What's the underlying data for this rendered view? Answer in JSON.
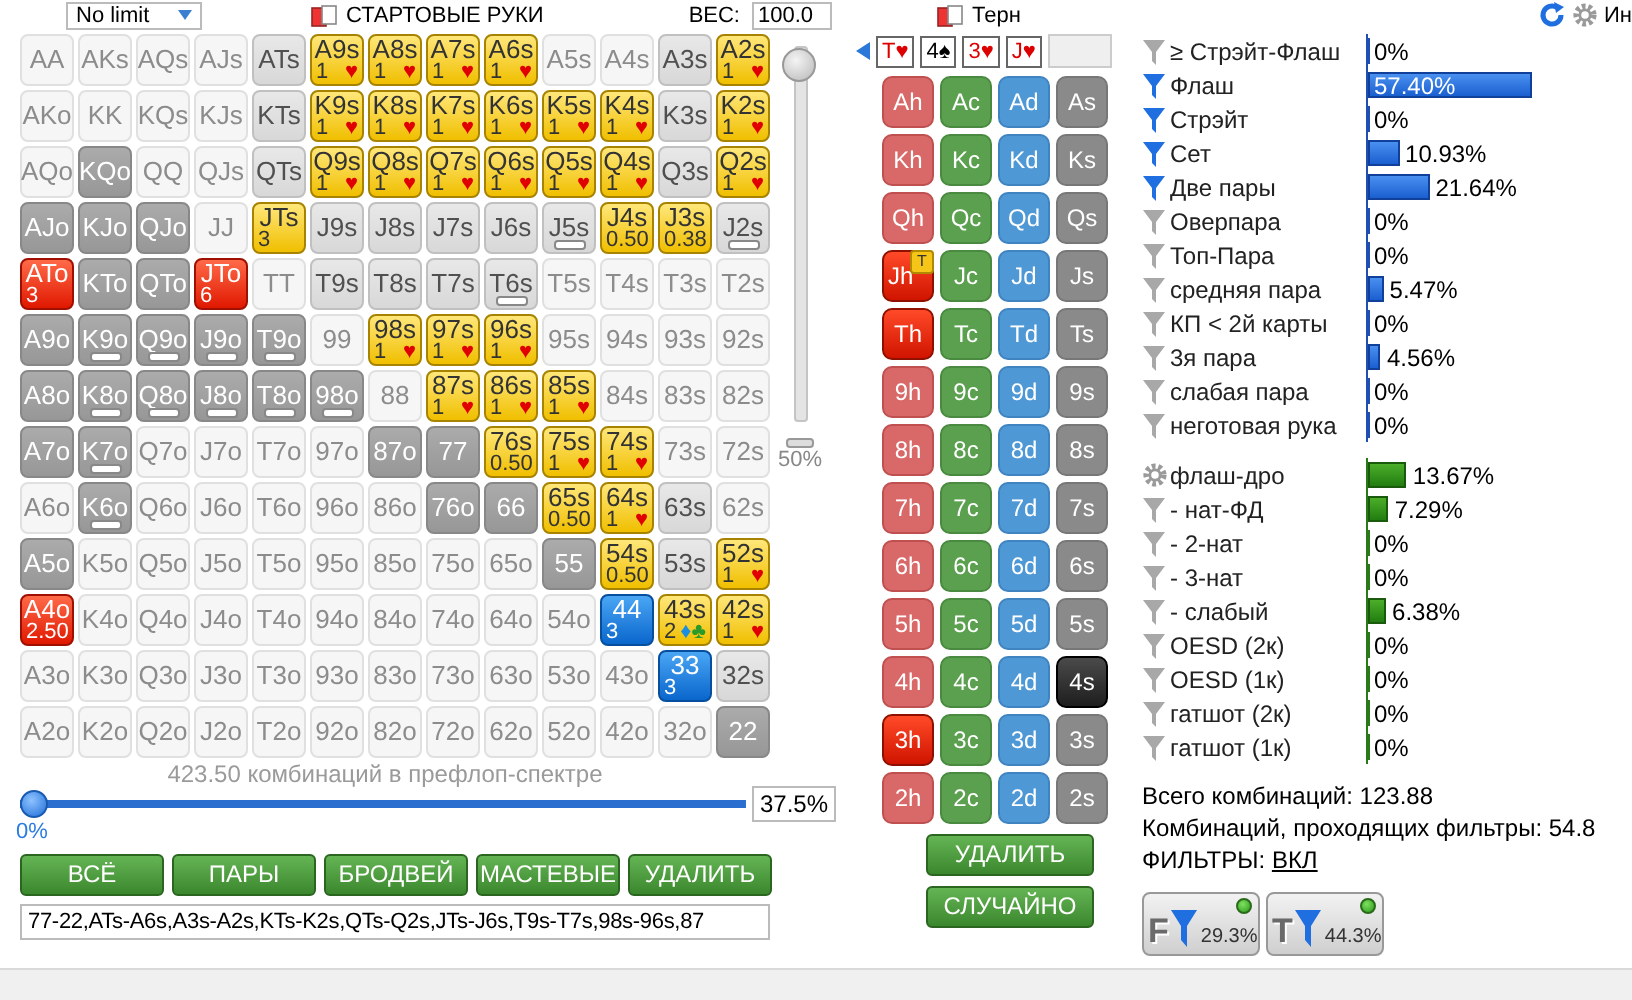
{
  "header": {
    "game": "No limit",
    "section": "СТАРТОВЫЕ РУКИ",
    "weight_label": "ВЕС:",
    "weight": "100.0",
    "street": "Терн",
    "info": "Ин"
  },
  "range": {
    "cells": [
      {
        "label": "AA",
        "kind": "faint",
        "bar": false
      },
      {
        "label": "AKs",
        "kind": "faint",
        "bar": false
      },
      {
        "label": "AQs",
        "kind": "faint",
        "bar": false
      },
      {
        "label": "AJs",
        "kind": "faint",
        "bar": false
      },
      {
        "label": "ATs",
        "kind": "mid",
        "bar": false
      },
      {
        "label": "A9s",
        "kind": "yellow",
        "bar": false,
        "count": "1",
        "suits": [
          {
            "symbol": "♥",
            "color": "#e00000"
          }
        ]
      },
      {
        "label": "A8s",
        "kind": "yellow",
        "bar": false,
        "count": "1",
        "suits": [
          {
            "symbol": "♥",
            "color": "#e00000"
          }
        ]
      },
      {
        "label": "A7s",
        "kind": "yellow",
        "bar": false,
        "count": "1",
        "suits": [
          {
            "symbol": "♥",
            "color": "#e00000"
          }
        ]
      },
      {
        "label": "A6s",
        "kind": "yellow",
        "bar": false,
        "count": "1",
        "suits": [
          {
            "symbol": "♥",
            "color": "#e00000"
          }
        ]
      },
      {
        "label": "A5s",
        "kind": "faint",
        "bar": false
      },
      {
        "label": "A4s",
        "kind": "faint",
        "bar": false
      },
      {
        "label": "A3s",
        "kind": "mid",
        "bar": false
      },
      {
        "label": "A2s",
        "kind": "yellow",
        "bar": false,
        "count": "1",
        "suits": [
          {
            "symbol": "♥",
            "color": "#e00000"
          }
        ]
      },
      {
        "label": "AKo",
        "kind": "faint",
        "bar": false
      },
      {
        "label": "KK",
        "kind": "faint",
        "bar": false
      },
      {
        "label": "KQs",
        "kind": "faint",
        "bar": false
      },
      {
        "label": "KJs",
        "kind": "faint",
        "bar": false
      },
      {
        "label": "KTs",
        "kind": "mid",
        "bar": false
      },
      {
        "label": "K9s",
        "kind": "yellow",
        "bar": false,
        "count": "1",
        "suits": [
          {
            "symbol": "♥",
            "color": "#e00000"
          }
        ]
      },
      {
        "label": "K8s",
        "kind": "yellow",
        "bar": false,
        "count": "1",
        "suits": [
          {
            "symbol": "♥",
            "color": "#e00000"
          }
        ]
      },
      {
        "label": "K7s",
        "kind": "yellow",
        "bar": false,
        "count": "1",
        "suits": [
          {
            "symbol": "♥",
            "color": "#e00000"
          }
        ]
      },
      {
        "label": "K6s",
        "kind": "yellow",
        "bar": false,
        "count": "1",
        "suits": [
          {
            "symbol": "♥",
            "color": "#e00000"
          }
        ]
      },
      {
        "label": "K5s",
        "kind": "yellow",
        "bar": false,
        "count": "1",
        "suits": [
          {
            "symbol": "♥",
            "color": "#e00000"
          }
        ]
      },
      {
        "label": "K4s",
        "kind": "yellow",
        "bar": false,
        "count": "1",
        "suits": [
          {
            "symbol": "♥",
            "color": "#e00000"
          }
        ]
      },
      {
        "label": "K3s",
        "kind": "mid",
        "bar": false
      },
      {
        "label": "K2s",
        "kind": "yellow",
        "bar": false,
        "count": "1",
        "suits": [
          {
            "symbol": "♥",
            "color": "#e00000"
          }
        ]
      },
      {
        "label": "AQo",
        "kind": "faint",
        "bar": false
      },
      {
        "label": "KQo",
        "kind": "dark",
        "bar": false
      },
      {
        "label": "QQ",
        "kind": "faint",
        "bar": false
      },
      {
        "label": "QJs",
        "kind": "faint",
        "bar": false
      },
      {
        "label": "QTs",
        "kind": "mid",
        "bar": false
      },
      {
        "label": "Q9s",
        "kind": "yellow",
        "bar": false,
        "count": "1",
        "suits": [
          {
            "symbol": "♥",
            "color": "#e00000"
          }
        ]
      },
      {
        "label": "Q8s",
        "kind": "yellow",
        "bar": false,
        "count": "1",
        "suits": [
          {
            "symbol": "♥",
            "color": "#e00000"
          }
        ]
      },
      {
        "label": "Q7s",
        "kind": "yellow",
        "bar": false,
        "count": "1",
        "suits": [
          {
            "symbol": "♥",
            "color": "#e00000"
          }
        ]
      },
      {
        "label": "Q6s",
        "kind": "yellow",
        "bar": false,
        "count": "1",
        "suits": [
          {
            "symbol": "♥",
            "color": "#e00000"
          }
        ]
      },
      {
        "label": "Q5s",
        "kind": "yellow",
        "bar": false,
        "count": "1",
        "suits": [
          {
            "symbol": "♥",
            "color": "#e00000"
          }
        ]
      },
      {
        "label": "Q4s",
        "kind": "yellow",
        "bar": false,
        "count": "1",
        "suits": [
          {
            "symbol": "♥",
            "color": "#e00000"
          }
        ]
      },
      {
        "label": "Q3s",
        "kind": "mid",
        "bar": false
      },
      {
        "label": "Q2s",
        "kind": "yellow",
        "bar": false,
        "count": "1",
        "suits": [
          {
            "symbol": "♥",
            "color": "#e00000"
          }
        ]
      },
      {
        "label": "AJo",
        "kind": "dark",
        "bar": false
      },
      {
        "label": "KJo",
        "kind": "dark",
        "bar": false
      },
      {
        "label": "QJo",
        "kind": "dark",
        "bar": false
      },
      {
        "label": "JJ",
        "kind": "faint",
        "bar": false
      },
      {
        "label": "JTs",
        "kind": "yellow",
        "bar": false,
        "count": "3"
      },
      {
        "label": "J9s",
        "kind": "mid",
        "bar": false
      },
      {
        "label": "J8s",
        "kind": "mid",
        "bar": false
      },
      {
        "label": "J7s",
        "kind": "mid",
        "bar": false
      },
      {
        "label": "J6s",
        "kind": "mid",
        "bar": false
      },
      {
        "label": "J5s",
        "kind": "mid",
        "bar": true
      },
      {
        "label": "J4s",
        "kind": "yellow",
        "bar": false,
        "count": "0.50"
      },
      {
        "label": "J3s",
        "kind": "yellow",
        "bar": false,
        "count": "0.38"
      },
      {
        "label": "J2s",
        "kind": "mid",
        "bar": true
      },
      {
        "label": "ATo",
        "kind": "red",
        "bar": false,
        "count": "3"
      },
      {
        "label": "KTo",
        "kind": "dark",
        "bar": false
      },
      {
        "label": "QTo",
        "kind": "dark",
        "bar": false
      },
      {
        "label": "JTo",
        "kind": "red",
        "bar": false,
        "count": "6"
      },
      {
        "label": "TT",
        "kind": "faint",
        "bar": false
      },
      {
        "label": "T9s",
        "kind": "mid",
        "bar": false
      },
      {
        "label": "T8s",
        "kind": "mid",
        "bar": false
      },
      {
        "label": "T7s",
        "kind": "mid",
        "bar": false
      },
      {
        "label": "T6s",
        "kind": "mid",
        "bar": true
      },
      {
        "label": "T5s",
        "kind": "faint",
        "bar": false
      },
      {
        "label": "T4s",
        "kind": "faint",
        "bar": false
      },
      {
        "label": "T3s",
        "kind": "faint",
        "bar": false
      },
      {
        "label": "T2s",
        "kind": "faint",
        "bar": false
      },
      {
        "label": "A9o",
        "kind": "dark",
        "bar": false
      },
      {
        "label": "K9o",
        "kind": "dark",
        "bar": true
      },
      {
        "label": "Q9o",
        "kind": "dark",
        "bar": true
      },
      {
        "label": "J9o",
        "kind": "dark",
        "bar": true
      },
      {
        "label": "T9o",
        "kind": "dark",
        "bar": true
      },
      {
        "label": "99",
        "kind": "faint",
        "bar": false
      },
      {
        "label": "98s",
        "kind": "yellow",
        "bar": false,
        "count": "1",
        "suits": [
          {
            "symbol": "♥",
            "color": "#e00000"
          }
        ]
      },
      {
        "label": "97s",
        "kind": "yellow",
        "bar": false,
        "count": "1",
        "suits": [
          {
            "symbol": "♥",
            "color": "#e00000"
          }
        ]
      },
      {
        "label": "96s",
        "kind": "yellow",
        "bar": false,
        "count": "1",
        "suits": [
          {
            "symbol": "♥",
            "color": "#e00000"
          }
        ]
      },
      {
        "label": "95s",
        "kind": "faint",
        "bar": false
      },
      {
        "label": "94s",
        "kind": "faint",
        "bar": false
      },
      {
        "label": "93s",
        "kind": "faint",
        "bar": false
      },
      {
        "label": "92s",
        "kind": "faint",
        "bar": false
      },
      {
        "label": "A8o",
        "kind": "dark",
        "bar": false
      },
      {
        "label": "K8o",
        "kind": "dark",
        "bar": true
      },
      {
        "label": "Q8o",
        "kind": "dark",
        "bar": true
      },
      {
        "label": "J8o",
        "kind": "dark",
        "bar": true
      },
      {
        "label": "T8o",
        "kind": "dark",
        "bar": true
      },
      {
        "label": "98o",
        "kind": "dark",
        "bar": true
      },
      {
        "label": "88",
        "kind": "faint",
        "bar": false
      },
      {
        "label": "87s",
        "kind": "yellow",
        "bar": false,
        "count": "1",
        "suits": [
          {
            "symbol": "♥",
            "color": "#e00000"
          }
        ]
      },
      {
        "label": "86s",
        "kind": "yellow",
        "bar": false,
        "count": "1",
        "suits": [
          {
            "symbol": "♥",
            "color": "#e00000"
          }
        ]
      },
      {
        "label": "85s",
        "kind": "yellow",
        "bar": false,
        "count": "1",
        "suits": [
          {
            "symbol": "♥",
            "color": "#e00000"
          }
        ]
      },
      {
        "label": "84s",
        "kind": "faint",
        "bar": false
      },
      {
        "label": "83s",
        "kind": "faint",
        "bar": false
      },
      {
        "label": "82s",
        "kind": "faint",
        "bar": false
      },
      {
        "label": "A7o",
        "kind": "dark",
        "bar": false
      },
      {
        "label": "K7o",
        "kind": "dark",
        "bar": true
      },
      {
        "label": "Q7o",
        "kind": "faint",
        "bar": false
      },
      {
        "label": "J7o",
        "kind": "faint",
        "bar": false
      },
      {
        "label": "T7o",
        "kind": "faint",
        "bar": false
      },
      {
        "label": "97o",
        "kind": "faint",
        "bar": false
      },
      {
        "label": "87o",
        "kind": "dark",
        "bar": false
      },
      {
        "label": "77",
        "kind": "dark",
        "bar": false
      },
      {
        "label": "76s",
        "kind": "yellow",
        "bar": false,
        "count": "0.50"
      },
      {
        "label": "75s",
        "kind": "yellow",
        "bar": false,
        "count": "1",
        "suits": [
          {
            "symbol": "♥",
            "color": "#e00000"
          }
        ]
      },
      {
        "label": "74s",
        "kind": "yellow",
        "bar": false,
        "count": "1",
        "suits": [
          {
            "symbol": "♥",
            "color": "#e00000"
          }
        ]
      },
      {
        "label": "73s",
        "kind": "faint",
        "bar": false
      },
      {
        "label": "72s",
        "kind": "faint",
        "bar": false
      },
      {
        "label": "A6o",
        "kind": "faint",
        "bar": false
      },
      {
        "label": "K6o",
        "kind": "dark",
        "bar": true
      },
      {
        "label": "Q6o",
        "kind": "faint",
        "bar": false
      },
      {
        "label": "J6o",
        "kind": "faint",
        "bar": false
      },
      {
        "label": "T6o",
        "kind": "faint",
        "bar": false
      },
      {
        "label": "96o",
        "kind": "faint",
        "bar": false
      },
      {
        "label": "86o",
        "kind": "faint",
        "bar": false
      },
      {
        "label": "76o",
        "kind": "dark",
        "bar": false
      },
      {
        "label": "66",
        "kind": "dark",
        "bar": false
      },
      {
        "label": "65s",
        "kind": "yellow",
        "bar": false,
        "count": "0.50"
      },
      {
        "label": "64s",
        "kind": "yellow",
        "bar": false,
        "count": "1",
        "suits": [
          {
            "symbol": "♥",
            "color": "#e00000"
          }
        ]
      },
      {
        "label": "63s",
        "kind": "mid",
        "bar": false
      },
      {
        "label": "62s",
        "kind": "faint",
        "bar": false
      },
      {
        "label": "A5o",
        "kind": "dark",
        "bar": false
      },
      {
        "label": "K5o",
        "kind": "faint",
        "bar": false
      },
      {
        "label": "Q5o",
        "kind": "faint",
        "bar": false
      },
      {
        "label": "J5o",
        "kind": "faint",
        "bar": false
      },
      {
        "label": "T5o",
        "kind": "faint",
        "bar": false
      },
      {
        "label": "95o",
        "kind": "faint",
        "bar": false
      },
      {
        "label": "85o",
        "kind": "faint",
        "bar": false
      },
      {
        "label": "75o",
        "kind": "faint",
        "bar": false
      },
      {
        "label": "65o",
        "kind": "faint",
        "bar": false
      },
      {
        "label": "55",
        "kind": "dark",
        "bar": false
      },
      {
        "label": "54s",
        "kind": "yellow",
        "bar": false,
        "count": "0.50"
      },
      {
        "label": "53s",
        "kind": "mid",
        "bar": false
      },
      {
        "label": "52s",
        "kind": "yellow",
        "bar": false,
        "count": "1",
        "suits": [
          {
            "symbol": "♥",
            "color": "#e00000"
          }
        ]
      },
      {
        "label": "A4o",
        "kind": "red",
        "bar": false,
        "count": "2.50"
      },
      {
        "label": "K4o",
        "kind": "faint",
        "bar": false
      },
      {
        "label": "Q4o",
        "kind": "faint",
        "bar": false
      },
      {
        "label": "J4o",
        "kind": "faint",
        "bar": false
      },
      {
        "label": "T4o",
        "kind": "faint",
        "bar": false
      },
      {
        "label": "94o",
        "kind": "faint",
        "bar": false
      },
      {
        "label": "84o",
        "kind": "faint",
        "bar": false
      },
      {
        "label": "74o",
        "kind": "faint",
        "bar": false
      },
      {
        "label": "64o",
        "kind": "faint",
        "bar": false
      },
      {
        "label": "54o",
        "kind": "faint",
        "bar": false
      },
      {
        "label": "44",
        "kind": "blue",
        "bar": false,
        "count": "3"
      },
      {
        "label": "43s",
        "kind": "yellow",
        "bar": false,
        "count": "2",
        "suits": [
          {
            "symbol": "♦",
            "color": "#1a8fe0"
          },
          {
            "symbol": "♣",
            "color": "#2a9a2a"
          }
        ]
      },
      {
        "label": "42s",
        "kind": "yellow",
        "bar": false,
        "count": "1",
        "suits": [
          {
            "symbol": "♥",
            "color": "#e00000"
          }
        ]
      },
      {
        "label": "A3o",
        "kind": "faint",
        "bar": false
      },
      {
        "label": "K3o",
        "kind": "faint",
        "bar": false
      },
      {
        "label": "Q3o",
        "kind": "faint",
        "bar": false
      },
      {
        "label": "J3o",
        "kind": "faint",
        "bar": false
      },
      {
        "label": "T3o",
        "kind": "faint",
        "bar": false
      },
      {
        "label": "93o",
        "kind": "faint",
        "bar": false
      },
      {
        "label": "83o",
        "kind": "faint",
        "bar": false
      },
      {
        "label": "73o",
        "kind": "faint",
        "bar": false
      },
      {
        "label": "63o",
        "kind": "faint",
        "bar": false
      },
      {
        "label": "53o",
        "kind": "faint",
        "bar": false
      },
      {
        "label": "43o",
        "kind": "faint",
        "bar": false
      },
      {
        "label": "33",
        "kind": "blue",
        "bar": false,
        "count": "3"
      },
      {
        "label": "32s",
        "kind": "mid",
        "bar": false
      },
      {
        "label": "A2o",
        "kind": "faint",
        "bar": false
      },
      {
        "label": "K2o",
        "kind": "faint",
        "bar": false
      },
      {
        "label": "Q2o",
        "kind": "faint",
        "bar": false
      },
      {
        "label": "J2o",
        "kind": "faint",
        "bar": false
      },
      {
        "label": "T2o",
        "kind": "faint",
        "bar": false
      },
      {
        "label": "92o",
        "kind": "faint",
        "bar": false
      },
      {
        "label": "82o",
        "kind": "faint",
        "bar": false
      },
      {
        "label": "72o",
        "kind": "faint",
        "bar": false
      },
      {
        "label": "62o",
        "kind": "faint",
        "bar": false
      },
      {
        "label": "52o",
        "kind": "faint",
        "bar": false
      },
      {
        "label": "42o",
        "kind": "faint",
        "bar": false
      },
      {
        "label": "32o",
        "kind": "faint",
        "bar": false
      },
      {
        "label": "22",
        "kind": "dark",
        "bar": false
      }
    ],
    "vertical_slider": {
      "level": 1,
      "reading": "50%"
    },
    "summary": "423.50 комбинаций в префлоп-спектре",
    "slider": {
      "level": 0,
      "min_label": "0%",
      "value": "37.5%"
    },
    "buttons": [
      "ВСЁ",
      "ПАРЫ",
      "БРОДВЕЙ",
      "МАСТЕВЫЕ",
      "УДАЛИТЬ"
    ],
    "text": "77-22,ATs-A6s,A3s-A2s,KTs-K2s,QTs-Q2s,JTs-J6s,T9s-T7s,98s-96s,87"
  },
  "board": {
    "cards": [
      {
        "kind": "card",
        "label": "T♥",
        "color": "#dd0000"
      },
      {
        "kind": "card",
        "label": "4♠",
        "color": "#000000"
      },
      {
        "kind": "card",
        "label": "3♥",
        "color": "#dd0000"
      },
      {
        "kind": "card",
        "label": "J♥",
        "color": "#dd0000"
      },
      {
        "kind": "empty"
      }
    ]
  },
  "deck": {
    "columns": [
      {
        "kind": "heart",
        "cards": [
          {
            "label": "Ah",
            "selected": false
          },
          {
            "label": "Kh",
            "selected": false
          },
          {
            "label": "Qh",
            "selected": false
          },
          {
            "label": "Jh",
            "selected": true,
            "badge": "T"
          },
          {
            "label": "Th",
            "selected": true
          },
          {
            "label": "9h",
            "selected": false
          },
          {
            "label": "8h",
            "selected": false
          },
          {
            "label": "7h",
            "selected": false
          },
          {
            "label": "6h",
            "selected": false
          },
          {
            "label": "5h",
            "selected": false
          },
          {
            "label": "4h",
            "selected": false
          },
          {
            "label": "3h",
            "selected": true
          },
          {
            "label": "2h",
            "selected": false
          }
        ]
      },
      {
        "kind": "club",
        "cards": [
          {
            "label": "Ac",
            "selected": false
          },
          {
            "label": "Kc",
            "selected": false
          },
          {
            "label": "Qc",
            "selected": false
          },
          {
            "label": "Jc",
            "selected": false
          },
          {
            "label": "Tc",
            "selected": false
          },
          {
            "label": "9c",
            "selected": false
          },
          {
            "label": "8c",
            "selected": false
          },
          {
            "label": "7c",
            "selected": false
          },
          {
            "label": "6c",
            "selected": false
          },
          {
            "label": "5c",
            "selected": false
          },
          {
            "label": "4c",
            "selected": false
          },
          {
            "label": "3c",
            "selected": false
          },
          {
            "label": "2c",
            "selected": false
          }
        ]
      },
      {
        "kind": "diamond",
        "cards": [
          {
            "label": "Ad",
            "selected": false
          },
          {
            "label": "Kd",
            "selected": false
          },
          {
            "label": "Qd",
            "selected": false
          },
          {
            "label": "Jd",
            "selected": false
          },
          {
            "label": "Td",
            "selected": false
          },
          {
            "label": "9d",
            "selected": false
          },
          {
            "label": "8d",
            "selected": false
          },
          {
            "label": "7d",
            "selected": false
          },
          {
            "label": "6d",
            "selected": false
          },
          {
            "label": "5d",
            "selected": false
          },
          {
            "label": "4d",
            "selected": false
          },
          {
            "label": "3d",
            "selected": false
          },
          {
            "label": "2d",
            "selected": false
          }
        ]
      },
      {
        "kind": "spade",
        "cards": [
          {
            "label": "As",
            "selected": false
          },
          {
            "label": "Ks",
            "selected": false
          },
          {
            "label": "Qs",
            "selected": false
          },
          {
            "label": "Js",
            "selected": false
          },
          {
            "label": "Ts",
            "selected": false
          },
          {
            "label": "9s",
            "selected": false
          },
          {
            "label": "8s",
            "selected": false
          },
          {
            "label": "7s",
            "selected": false
          },
          {
            "label": "6s",
            "selected": false
          },
          {
            "label": "5s",
            "selected": false
          },
          {
            "label": "4s",
            "selected": true
          },
          {
            "label": "3s",
            "selected": false
          },
          {
            "label": "2s",
            "selected": false
          }
        ]
      }
    ],
    "buttons": [
      "УДАЛИТЬ",
      "СЛУЧАЙНО"
    ]
  },
  "filters": {
    "made": [
      {
        "kind": "funnel",
        "label": "≥ Стрэйт-Флаш",
        "active": false,
        "level": 0,
        "reading": "0%"
      },
      {
        "kind": "funnel",
        "label": "Флаш",
        "active": true,
        "level": 0.574,
        "reading": "57.40%"
      },
      {
        "kind": "funnel",
        "label": "Стрэйт",
        "active": true,
        "level": 0,
        "reading": "0%"
      },
      {
        "kind": "funnel",
        "label": "Сет",
        "active": true,
        "level": 0.1093,
        "reading": "10.93%"
      },
      {
        "kind": "funnel",
        "label": "Две пары",
        "active": true,
        "level": 0.2164,
        "reading": "21.64%"
      },
      {
        "kind": "funnel",
        "label": "Оверпара",
        "active": false,
        "level": 0,
        "reading": "0%"
      },
      {
        "kind": "funnel",
        "label": "Топ-Пара",
        "active": false,
        "level": 0,
        "reading": "0%"
      },
      {
        "kind": "funnel",
        "label": "средняя пара",
        "active": false,
        "level": 0.0547,
        "reading": "5.47%"
      },
      {
        "kind": "funnel",
        "label": "КП < 2й карты",
        "active": false,
        "level": 0,
        "reading": "0%"
      },
      {
        "kind": "funnel",
        "label": "3я пара",
        "active": false,
        "level": 0.0456,
        "reading": "4.56%"
      },
      {
        "kind": "funnel",
        "label": "слабая пара",
        "active": false,
        "level": 0,
        "reading": "0%"
      },
      {
        "kind": "funnel",
        "label": "неготовая рука",
        "active": false,
        "level": 0,
        "reading": "0%"
      }
    ],
    "draws": [
      {
        "kind": "gear",
        "label": "флаш-дро",
        "active": false,
        "level": 0.1367,
        "reading": "13.67%"
      },
      {
        "kind": "funnel",
        "label": "- нат-ФД",
        "active": false,
        "level": 0.0729,
        "reading": "7.29%"
      },
      {
        "kind": "funnel",
        "label": "- 2-нат",
        "active": false,
        "level": 0,
        "reading": "0%"
      },
      {
        "kind": "funnel",
        "label": "- 3-нат",
        "active": false,
        "level": 0,
        "reading": "0%"
      },
      {
        "kind": "funnel",
        "label": "- слабый",
        "active": false,
        "level": 0.0638,
        "reading": "6.38%"
      },
      {
        "kind": "funnel",
        "label": "OESD (2к)",
        "active": false,
        "level": 0,
        "reading": "0%"
      },
      {
        "kind": "funnel",
        "label": "OESD (1к)",
        "active": false,
        "level": 0,
        "reading": "0%"
      },
      {
        "kind": "funnel",
        "label": "гатшот (2к)",
        "active": false,
        "level": 0,
        "reading": "0%"
      },
      {
        "kind": "funnel",
        "label": "гатшот (1к)",
        "active": false,
        "level": 0,
        "reading": "0%"
      }
    ]
  },
  "totals": [
    "Всего комбинаций: 123.88",
    "Комбинаций, проходящих фильтры: 54.8"
  ],
  "filters_toggle": {
    "label": "ФИЛЬТРЫ:",
    "link": "ВКЛ"
  },
  "quick_filters": [
    {
      "letter": "F",
      "reading": "29.3%",
      "on": true
    },
    {
      "letter": "T",
      "reading": "44.3%",
      "on": true
    }
  ]
}
